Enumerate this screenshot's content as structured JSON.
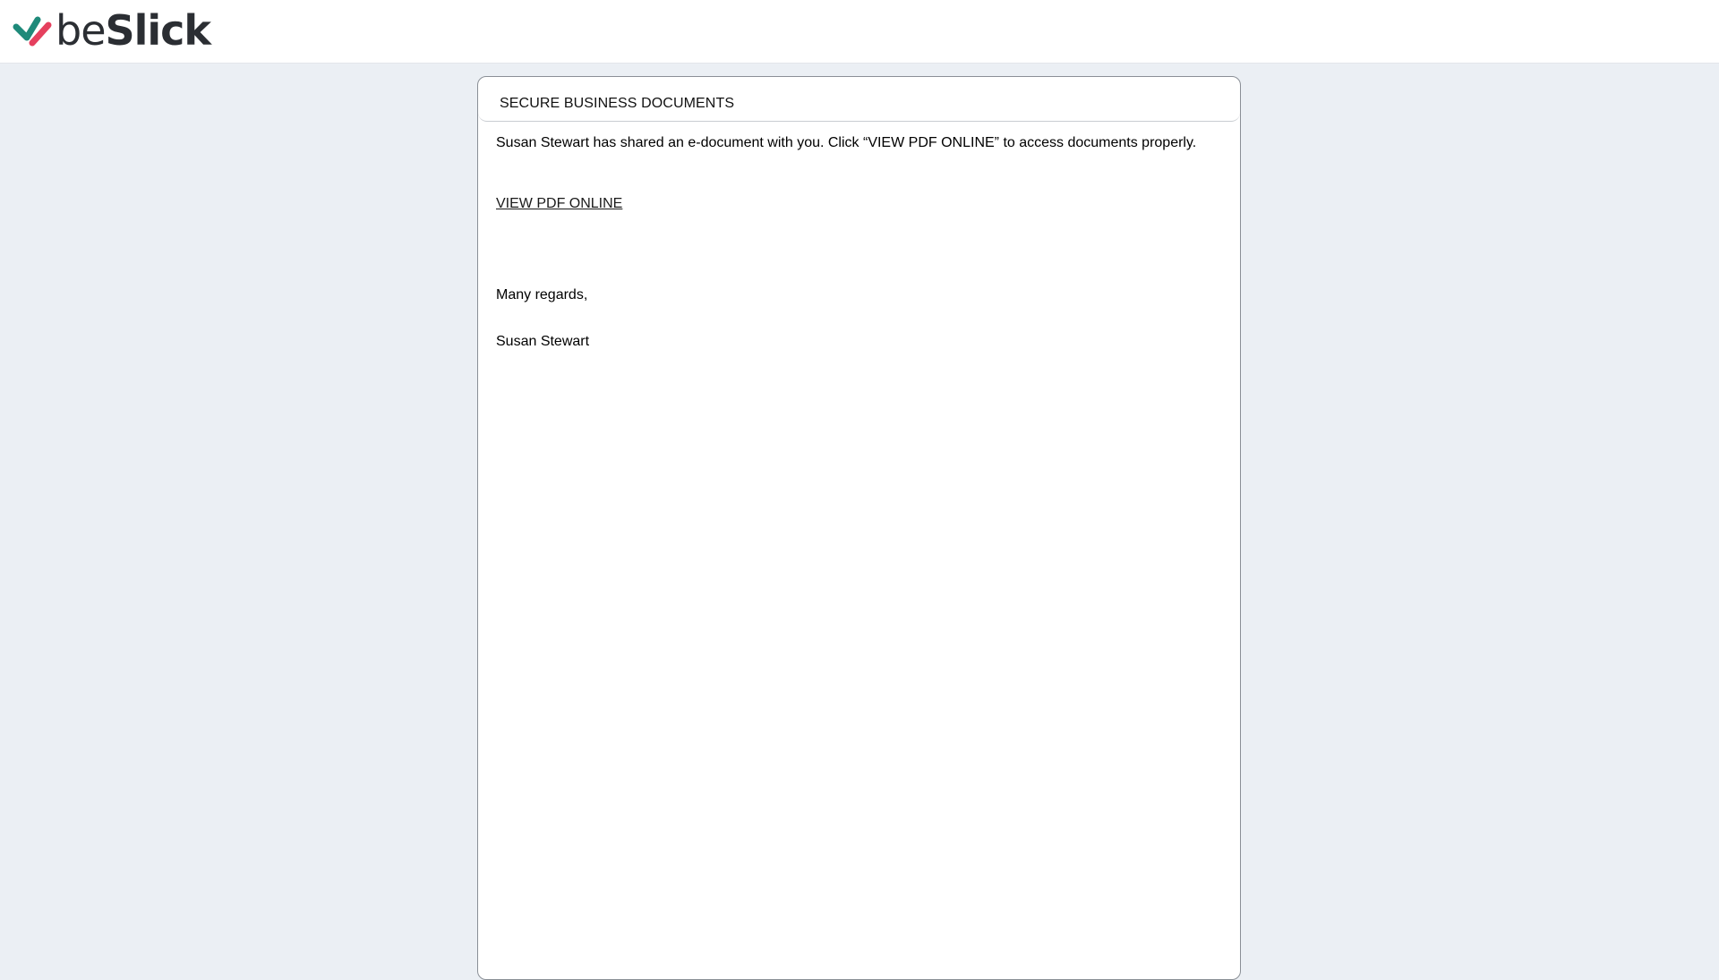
{
  "header": {
    "logo": {
      "icon": "beslick-check-icon",
      "text_light": "be",
      "text_bold": "Slick",
      "colors": {
        "check_green": "#1e8a7a",
        "check_pink": "#e5405e",
        "text": "#2b2e33"
      }
    }
  },
  "panel": {
    "title": "SECURE BUSINESS DOCUMENTS",
    "message": {
      "intro": "Susan Stewart has shared an e-document with you. Click “VIEW PDF ONLINE” to access documents properly.",
      "link_label": "VIEW PDF ONLINE",
      "closing": "Many regards,",
      "signature": "Susan Stewart"
    }
  },
  "colors": {
    "page_background": "#ebeff4",
    "panel_background": "#ffffff",
    "panel_border": "#8a8f96"
  }
}
